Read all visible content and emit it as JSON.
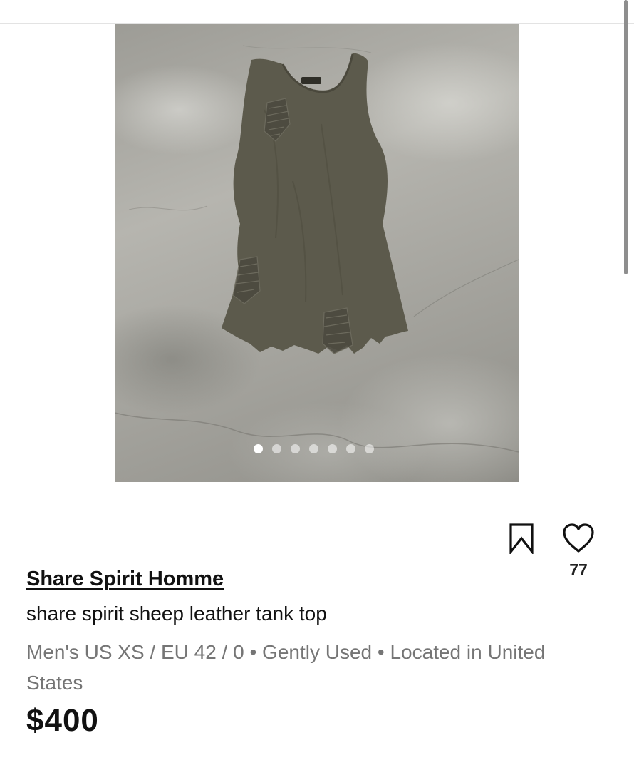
{
  "listing": {
    "image_count": 7,
    "active_image_index": 0,
    "brand": "Share Spirit Homme",
    "title": "share spirit sheep leather tank top",
    "details": "Men's US XS / EU 42 / 0 • Gently Used • Located in United States",
    "price": "$400",
    "like_count": "77"
  },
  "icons": {
    "bookmark": "bookmark-icon",
    "like": "heart-icon"
  },
  "colors": {
    "text_primary": "#111111",
    "text_secondary": "#757575",
    "garment": "#5c5a4c",
    "background": "#ffffff"
  }
}
